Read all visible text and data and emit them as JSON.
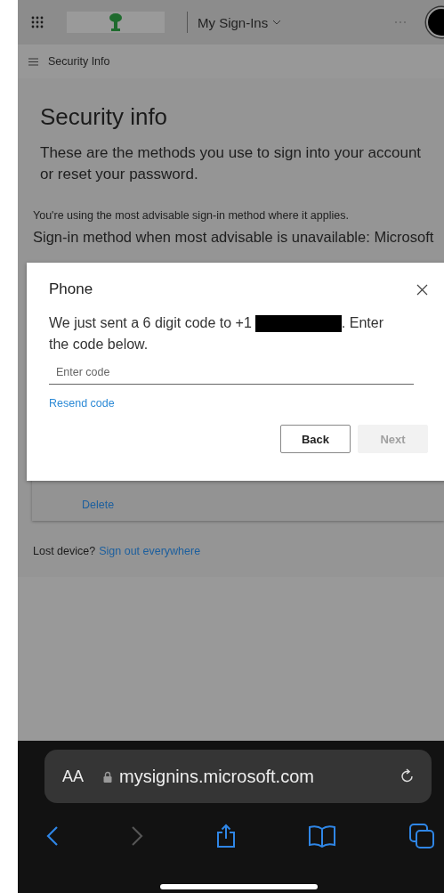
{
  "header": {
    "app_title": "My Sign-Ins"
  },
  "nav": {
    "title": "Security Info"
  },
  "page": {
    "title": "Security info",
    "description": "These are the methods you use to sign into your account or reset your password.",
    "advisable_note": "You're using the most advisable sign-in method where it applies.",
    "fallback_method": "Sign-in method when most advisable is unavailable: Microsoft"
  },
  "device_card": {
    "delete_link": "Delete"
  },
  "lost_device": {
    "label": "Lost device?",
    "link": "Sign out everywhere"
  },
  "dialog": {
    "title": "Phone",
    "message_before": "We just sent a 6 digit code to +1",
    "message_after": ". Enter",
    "message_line2": "the code below.",
    "code_field": {
      "placeholder": "Enter code"
    },
    "resend_link": "Resend code",
    "buttons": [
      {
        "label": "Back",
        "disabled": false
      },
      {
        "label": "Next",
        "disabled": true
      }
    ]
  },
  "browser": {
    "text_size": "AA",
    "url": "mysignins.microsoft.com",
    "back_enabled": true,
    "forward_enabled": false
  }
}
